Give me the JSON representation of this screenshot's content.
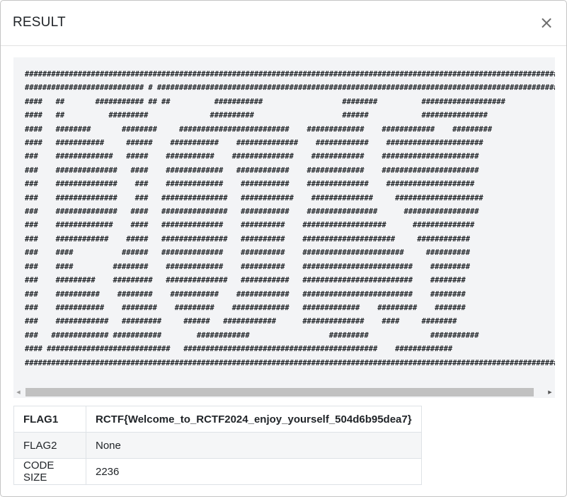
{
  "modal": {
    "title": "RESULT",
    "close_label": "×"
  },
  "ascii_art": "#########################################################################################################################\n########################### # ###########################################################################################\n####   ##       ########### ## ##          ###########                  ########          ###################\n####   ##          #########              ##########                    ######            ###############\n####   ########       ########     #########################    #############    ############    #########\n####   ###########     ######    ###########    ##############    ############    ######################\n###    #############   #####    ###########    ##############    ############    ######################\n###    ##############   ####    #############   ############    #############    ######################\n###    ##############    ###    #############    ###########    ##############    ####################\n###    ##############    ###   ###############   ############    ##############     ####################\n###    ##############   ####   ###############   ###########    ################      #################\n###    #############    ####   ##############    ##########    ###################      ##############\n###    ############    #####   ###############   ##########    #####################     ############\n###    ####           ######   ##############    ##########    #######################     ##########\n###    ####         ########    #############    ##########    #########################    #########\n###    #########    #########   ##############   ###########   #########################    ########\n###    ##########    ########    ###########    ############   #########################    ########\n###    ###########    ########    #########    #############   #############    #########    #######\n###    ############   #########     ######   ############      ##############    ####     ########\n###   ############# ###########        ############                  #########              ###########\n#### ############################   ############################################    #############\n#########################################################################################################################",
  "table": {
    "rows": [
      {
        "key": "FLAG1",
        "value": "RCTF{Welcome_to_RCTF2024_enjoy_yourself_504d6b95dea7}"
      },
      {
        "key": "FLAG2",
        "value": "None"
      },
      {
        "key": "CODE SIZE",
        "value": "2236"
      }
    ]
  },
  "icons": {
    "close": "close-icon",
    "scroll_left": "chevron-left-icon",
    "scroll_right": "chevron-right-icon"
  }
}
